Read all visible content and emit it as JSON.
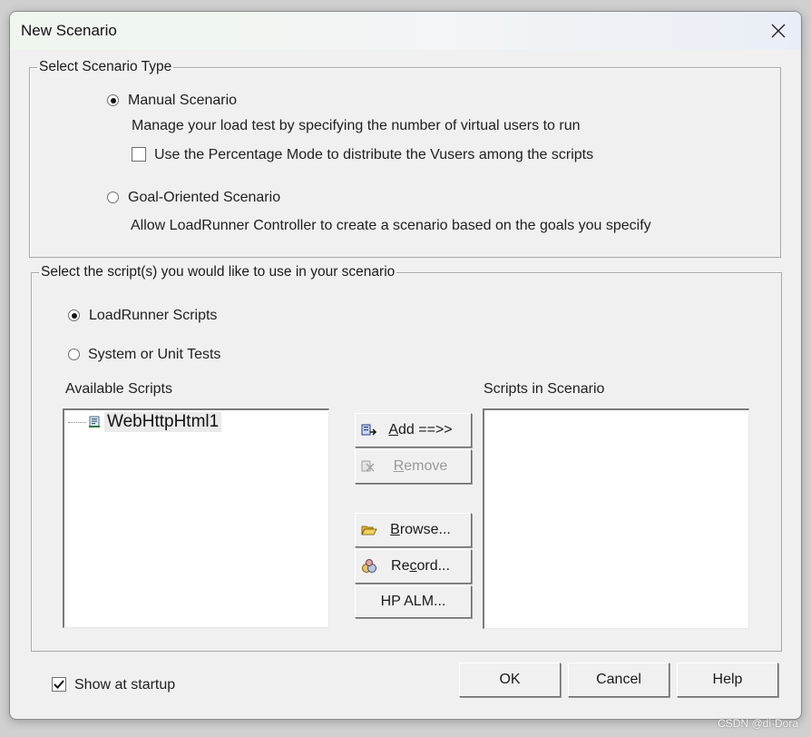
{
  "window": {
    "title": "New Scenario"
  },
  "scenario_type": {
    "legend": "Select Scenario Type",
    "manual": {
      "label": "Manual Scenario",
      "description": "Manage your load test by specifying the number of virtual users to run",
      "selected": true
    },
    "percentage_mode": {
      "label": "Use the Percentage Mode to distribute the Vusers among the scripts",
      "checked": false
    },
    "goal": {
      "label": "Goal-Oriented Scenario",
      "description": "Allow LoadRunner Controller to create a scenario based on the goals you specify",
      "selected": false
    }
  },
  "scripts": {
    "legend": "Select the script(s) you would like to use in your scenario",
    "loadrunner": {
      "label": "LoadRunner Scripts",
      "selected": true
    },
    "system_tests": {
      "label": "System or Unit Tests",
      "selected": false
    },
    "available": {
      "label": "Available Scripts",
      "items": [
        "WebHttpHtml1"
      ]
    },
    "in_scenario": {
      "label": "Scripts in Scenario",
      "items": []
    },
    "buttons": {
      "add": {
        "mnemonic": "A",
        "rest": "dd ==>>"
      },
      "remove": {
        "mnemonic": "R",
        "rest": "emove"
      },
      "browse": {
        "mnemonic": "B",
        "rest": "rowse..."
      },
      "record": {
        "pre": "Re",
        "mnemonic": "c",
        "rest": "ord..."
      },
      "hp_alm": "HP ALM..."
    }
  },
  "footer": {
    "show_at_startup": {
      "label": "Show at startup",
      "checked": true
    },
    "ok": "OK",
    "cancel": "Cancel",
    "help": "Help"
  },
  "watermark": "CSDN @di-Dora",
  "icons": {
    "close": "close-icon",
    "script": "script-icon",
    "add": "add-script-icon",
    "remove": "remove-script-icon",
    "browse": "folder-open-icon",
    "record": "record-icon"
  }
}
